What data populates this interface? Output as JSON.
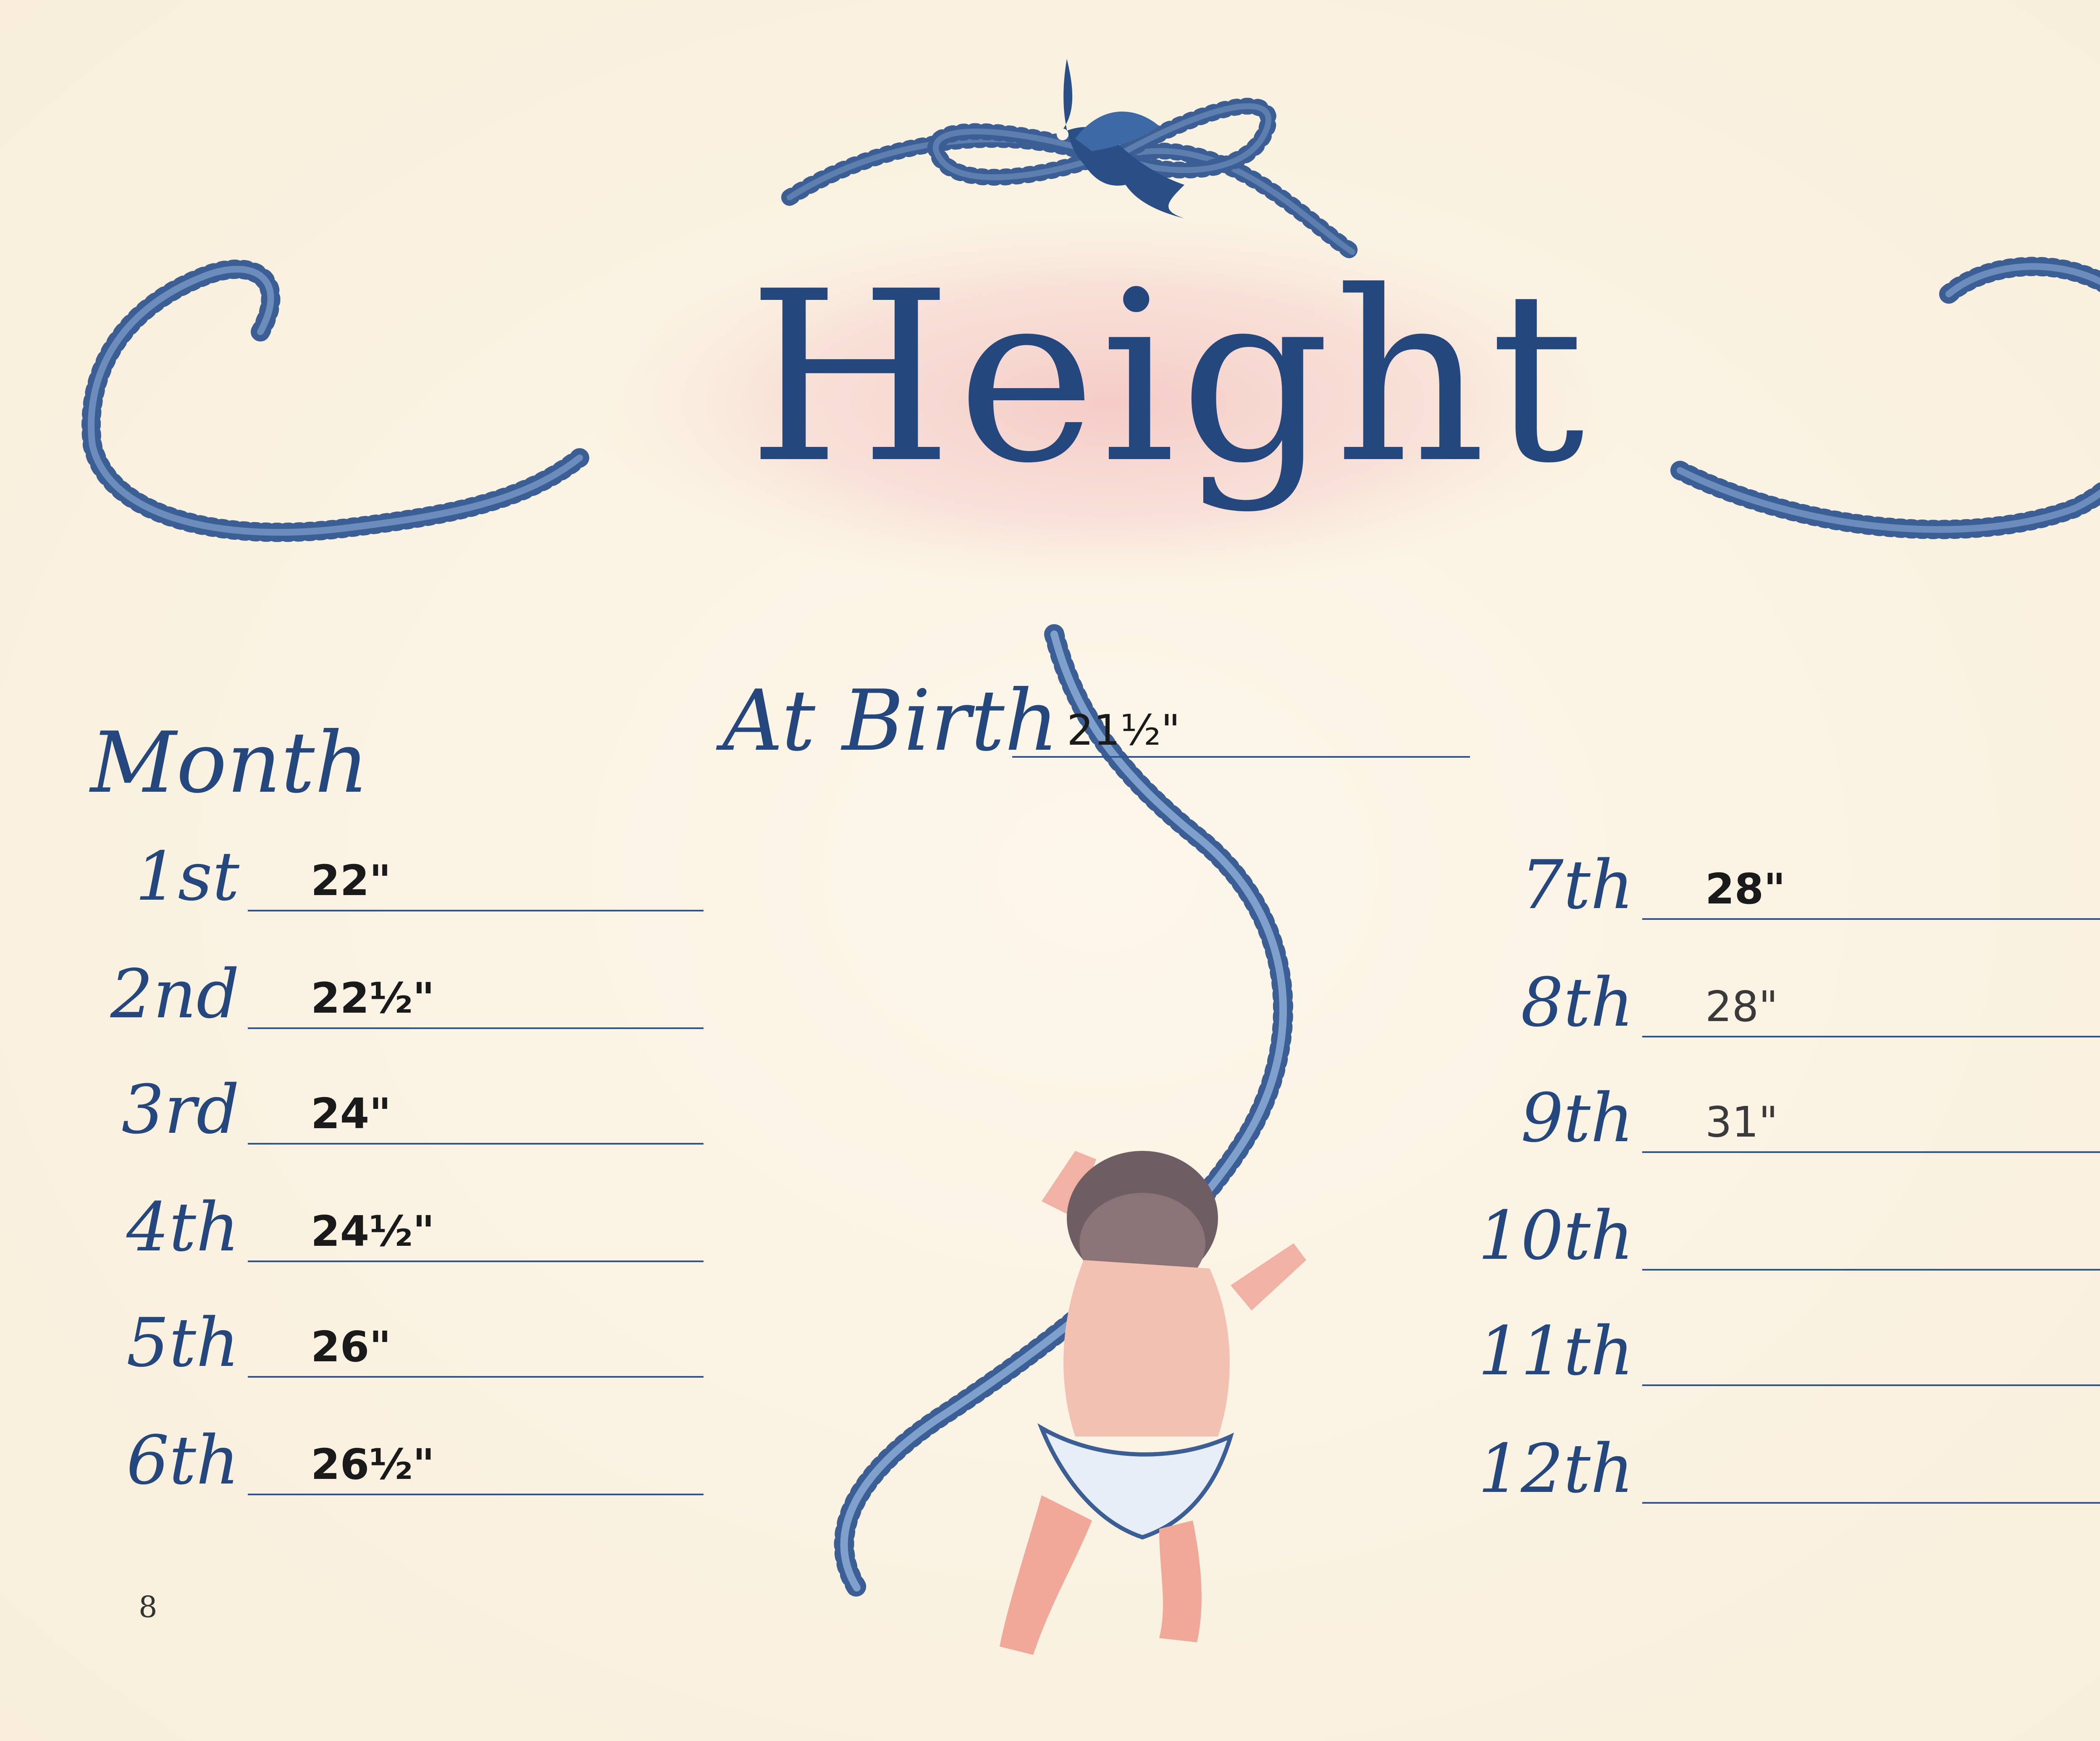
{
  "title": "Height",
  "birth": {
    "label": "At Birth",
    "value": "21½\""
  },
  "month_label": "Month",
  "months_left": [
    {
      "ord": "1st",
      "value": "22\""
    },
    {
      "ord": "2nd",
      "value": "22½\""
    },
    {
      "ord": "3rd",
      "value": "24\""
    },
    {
      "ord": "4th",
      "value": "24½\""
    },
    {
      "ord": "5th",
      "value": "26\""
    },
    {
      "ord": "6th",
      "value": "26½\""
    }
  ],
  "months_right": [
    {
      "ord": "7th",
      "value": "28\""
    },
    {
      "ord": "8th",
      "value": "28\""
    },
    {
      "ord": "9th",
      "value": "31\""
    },
    {
      "ord": "10th",
      "value": ""
    },
    {
      "ord": "11th",
      "value": ""
    },
    {
      "ord": "12th",
      "value": ""
    }
  ],
  "page_number": "8",
  "colors": {
    "ink": "#24477e",
    "tape": "#3b5f95",
    "pink": "#f3c9c6",
    "paper": "#fbf3e3",
    "pencil": "#1a1a1a"
  },
  "illustration": {
    "bird": "bluebird-icon",
    "baby": "baby-illustration",
    "tape": "measuring-tape"
  }
}
